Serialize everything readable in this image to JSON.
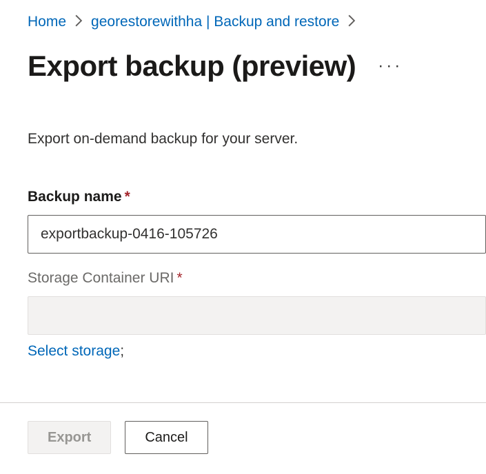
{
  "breadcrumb": {
    "home": "Home",
    "resource": "georestorewithha | Backup and restore"
  },
  "title": "Export backup (preview)",
  "description": "Export on-demand backup for your server.",
  "form": {
    "backup_name_label": "Backup name",
    "backup_name_value": "exportbackup-0416-105726",
    "storage_uri_label": "Storage Container URI",
    "storage_uri_value": "",
    "select_storage_label": "Select storage"
  },
  "footer": {
    "export_label": "Export",
    "cancel_label": "Cancel"
  }
}
